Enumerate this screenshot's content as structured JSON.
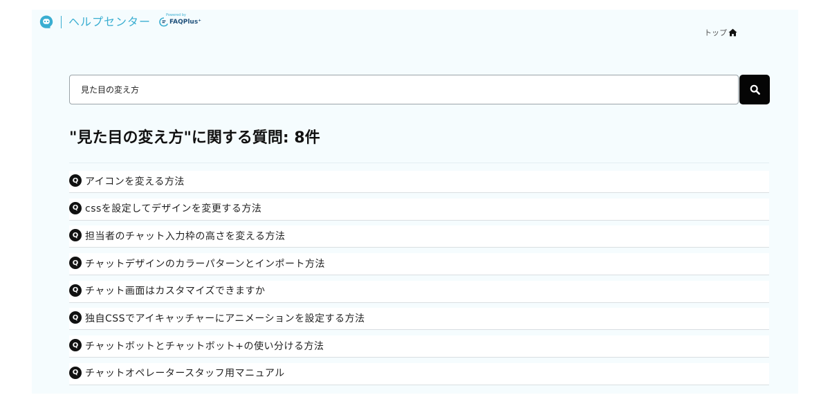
{
  "header": {
    "brand_title": "ヘルプセンター",
    "powered_by": "Powered by",
    "faq_brand": "FAQPlus⁺",
    "top_link_label": "トップ"
  },
  "search": {
    "value": "見た目の変え方",
    "button_icon": "search-icon"
  },
  "results": {
    "title": "\"見た目の変え方\"に関する質問: 8件",
    "badge": "Q",
    "items": [
      "アイコンを変える方法",
      "cssを設定してデザインを変更する方法",
      "担当者のチャット入力枠の高さを変える方法",
      "チャットデザインのカラーパターンとインポート方法",
      "チャット画面はカスタマイズできますか",
      "独自CSSでアイキャッチャーにアニメーションを設定する方法",
      "チャットボットとチャットボット+の使い分ける方法",
      "チャットオペレータースタッフ用マニュアル"
    ]
  },
  "colors": {
    "brand": "#3aaed1",
    "panel_background": "#f5fcfe",
    "search_button": "#050505",
    "badge": "#111111"
  }
}
